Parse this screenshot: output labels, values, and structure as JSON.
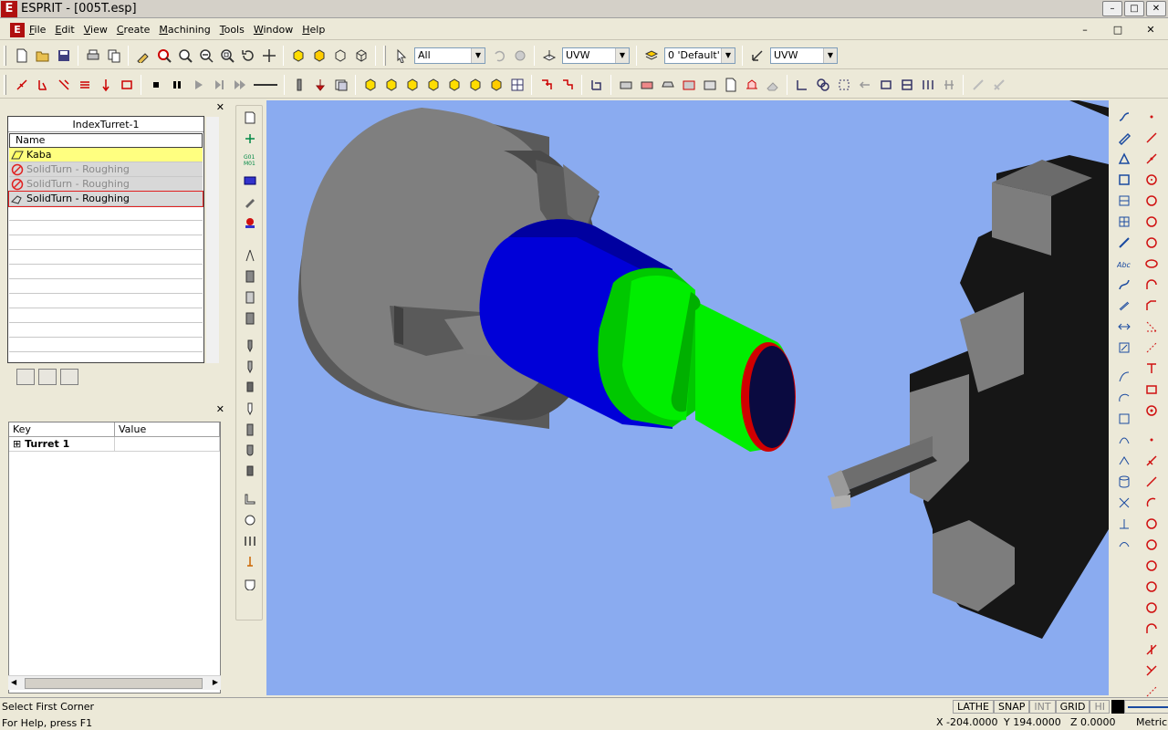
{
  "window": {
    "title": "ESPRIT - [005T.esp]",
    "logo": "E",
    "minimize": "–",
    "maximize": "□",
    "close": "✕"
  },
  "menu": [
    "File",
    "Edit",
    "View",
    "Create",
    "Machining",
    "Tools",
    "Window",
    "Help"
  ],
  "toolbar2": {
    "select_filter": "All",
    "plane1": "UVW",
    "layer": "0 'Default'",
    "plane2": "UVW"
  },
  "tree": {
    "title": "IndexTurret-1",
    "column": "Name",
    "rows": [
      {
        "label": "Kaba",
        "state": "active"
      },
      {
        "label": "SolidTurn - Roughing",
        "state": "disabled"
      },
      {
        "label": "SolidTurn - Roughing",
        "state": "disabled"
      },
      {
        "label": "SolidTurn - Roughing",
        "state": "selected"
      }
    ]
  },
  "properties": {
    "key_header": "Key",
    "value_header": "Value",
    "rows": [
      {
        "expander": "⊞",
        "key": "Turret 1",
        "value": ""
      }
    ]
  },
  "status": {
    "prompt": "Select First Corner",
    "help": "For Help, press F1",
    "flags": [
      {
        "label": "LATHE",
        "on": true
      },
      {
        "label": "SNAP",
        "on": true
      },
      {
        "label": "INT",
        "on": false
      },
      {
        "label": "GRID",
        "on": true
      },
      {
        "label": "HI",
        "on": false
      }
    ],
    "x": "X -204.0000",
    "y": "Y 194.0000",
    "z": "Z 0.0000",
    "units": "Metric"
  },
  "colors": {
    "viewport_bg": "#8aabf0",
    "stock": "#0000e0",
    "part": "#00ee00",
    "chuck": "#7f7f7f",
    "edge_highlight": "#d01010"
  },
  "icons": {
    "toolbar1": [
      "new-icon",
      "open-icon",
      "save-icon",
      "print-icon",
      "copy-icon",
      "select-icon",
      "zoom-in-icon",
      "zoom-icon",
      "zoom-out-icon",
      "zoom-window-icon",
      "rotate-icon",
      "pan-icon",
      "shaded-icon",
      "solid-icon",
      "wireframe-icon",
      "hidden-icon"
    ],
    "toolbar2": [
      "pointer-icon",
      "undo-icon",
      "redo-icon",
      "plane-icon",
      "layer-icon",
      "work-coordinate-icon"
    ],
    "toolbar3": [
      "turning-icon",
      "roughing-icon",
      "grooving-icon",
      "threading-icon",
      "drilling-icon",
      "cutoff-icon",
      "stop-icon",
      "pause-icon",
      "play-icon",
      "step-icon",
      "fast-forward-icon",
      "line-icon",
      "tool-icon",
      "spindle-icon",
      "sim-icon"
    ]
  }
}
